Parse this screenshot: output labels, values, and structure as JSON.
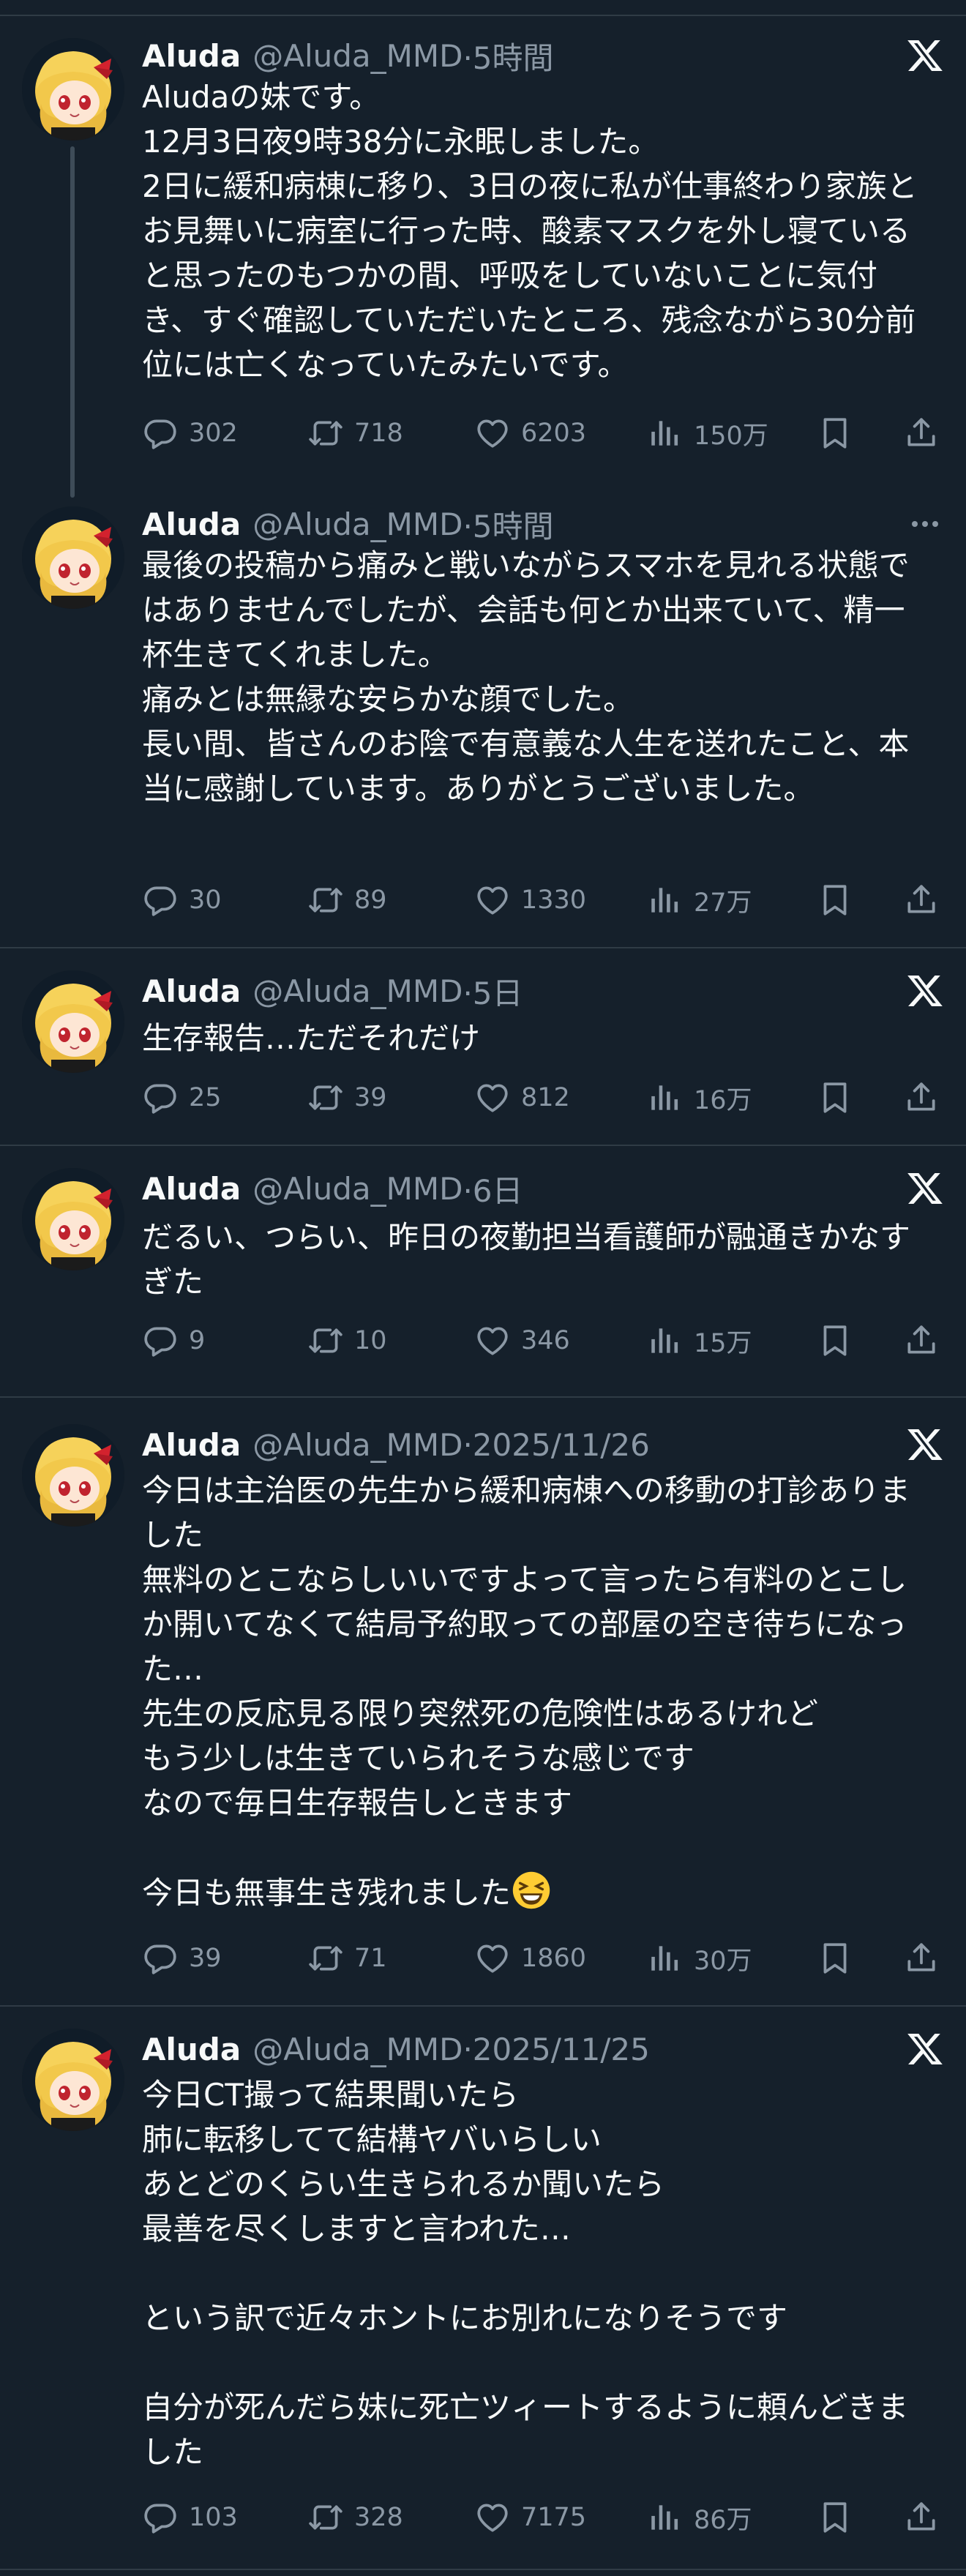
{
  "tweets": [
    {
      "name": "Aluda",
      "handle": "@Aluda_MMD",
      "time": "·5時間",
      "corner_icon": "x-logo-icon",
      "text": "Aludaの妹です。\n12月3日夜9時38分に永眠しました。\n2日に緩和病棟に移り、3日の夜に私が仕事終わり家族とお見舞いに病室に行った時、酸素マスクを外し寝ていると思ったのもつかの間、呼吸をしていないことに気付き、すぐ確認していただいたところ、残念ながら30分前位には亡くなっていたみたいです。",
      "replies": "302",
      "retweets": "718",
      "likes": "6203",
      "views": "150万"
    },
    {
      "name": "Aluda",
      "handle": "@Aluda_MMD",
      "time": "·5時間",
      "corner_icon": "more-icon",
      "text": "最後の投稿から痛みと戦いながらスマホを見れる状態ではありませんでしたが、会話も何とか出来ていて、精一杯生きてくれました。\n痛みとは無縁な安らかな顔でした。\n長い間、皆さんのお陰で有意義な人生を送れたこと、本当に感謝しています。ありがとうございました。",
      "replies": "30",
      "retweets": "89",
      "likes": "1330",
      "views": "27万"
    },
    {
      "name": "Aluda",
      "handle": "@Aluda_MMD",
      "time": "·5日",
      "corner_icon": "x-logo-icon",
      "text": "生存報告…ただそれだけ",
      "replies": "25",
      "retweets": "39",
      "likes": "812",
      "views": "16万"
    },
    {
      "name": "Aluda",
      "handle": "@Aluda_MMD",
      "time": "·6日",
      "corner_icon": "x-logo-icon",
      "text": "だるい、つらい、昨日の夜勤担当看護師が融通きかなすぎた",
      "replies": "9",
      "retweets": "10",
      "likes": "346",
      "views": "15万"
    },
    {
      "name": "Aluda",
      "handle": "@Aluda_MMD",
      "time": "·2025/11/26",
      "corner_icon": "x-logo-icon",
      "text": "今日は主治医の先生から緩和病棟への移動の打診ありました\n無料のとこならしいいですよって言ったら有料のとこしか開いてなくて結局予約取っての部屋の空き待ちになった…\n先生の反応見る限り突然死の危険性はあるけれど\nもう少しは生きていられそうな感じです\nなので毎日生存報告しときます\n\n今日も無事生き残れました",
      "emoji": "laughing-face-emoji",
      "replies": "39",
      "retweets": "71",
      "likes": "1860",
      "views": "30万"
    },
    {
      "name": "Aluda",
      "handle": "@Aluda_MMD",
      "time": "·2025/11/25",
      "corner_icon": "x-logo-icon",
      "text": "今日CT撮って結果聞いたら\n肺に転移してて結構ヤバいらしい\nあとどのくらい生きられるか聞いたら\n最善を尽くしますと言われた…\n\nという訳で近々ホントにお別れになりそうです\n\n自分が死んだら妹に死亡ツィートするように頼んどきました",
      "replies": "103",
      "retweets": "328",
      "likes": "7175",
      "views": "86万"
    }
  ],
  "colors": {
    "background": "#15202b",
    "text": "#f7f9f9",
    "secondary": "#8b98a5",
    "divider": "#2f3b45"
  }
}
